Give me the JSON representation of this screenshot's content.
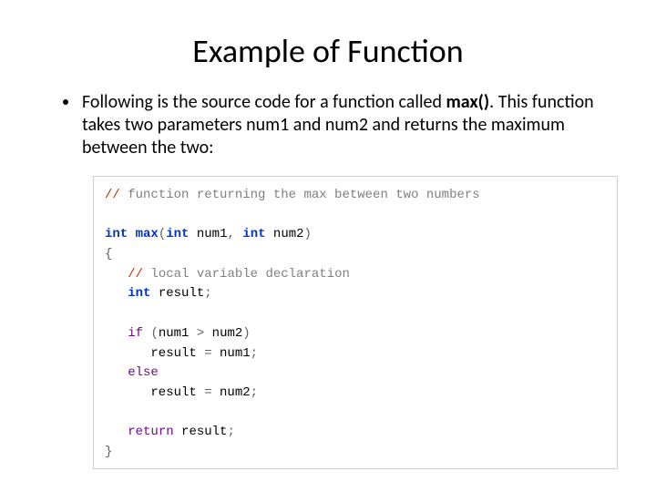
{
  "title": "Example of Function",
  "bullet": {
    "pre": "Following is the source code for a function called ",
    "bold": "max()",
    "post": ". This function takes two parameters num1 and num2 and returns the maximum between the two:"
  },
  "code": {
    "l1_slashes": "//",
    "l1_comment": " function returning the max between two numbers",
    "blank": "",
    "l2_kw": "int",
    "l2_sp1": " ",
    "l2_func": "max",
    "l2_open": "(",
    "l2_kw2": "int",
    "l2_sp2": " num1",
    "l2_comma": ",",
    "l2_sp3": " ",
    "l2_kw3": "int",
    "l2_sp4": " num2",
    "l2_close": ")",
    "l3_brace": "{",
    "l4_indent": "   ",
    "l4_slashes": "//",
    "l4_comment": " local variable declaration",
    "l5_indent": "   ",
    "l5_kw": "int",
    "l5_rest": " result",
    "l5_semi": ";",
    "l6_indent": "   ",
    "l6_kw": "if",
    "l6_sp": " ",
    "l6_open": "(",
    "l6_a": "num1 ",
    "l6_op": ">",
    "l6_b": " num2",
    "l6_close": ")",
    "l7_indent": "      result ",
    "l7_eq": "=",
    "l7_rest": " num1",
    "l7_semi": ";",
    "l8_indent": "   ",
    "l8_kw": "else",
    "l9_indent": "      result ",
    "l9_eq": "=",
    "l9_rest": " num2",
    "l9_semi": ";",
    "l10_indent": "   ",
    "l10_kw": "return",
    "l10_rest": " result",
    "l10_semi": ";",
    "l11_brace": "}"
  }
}
